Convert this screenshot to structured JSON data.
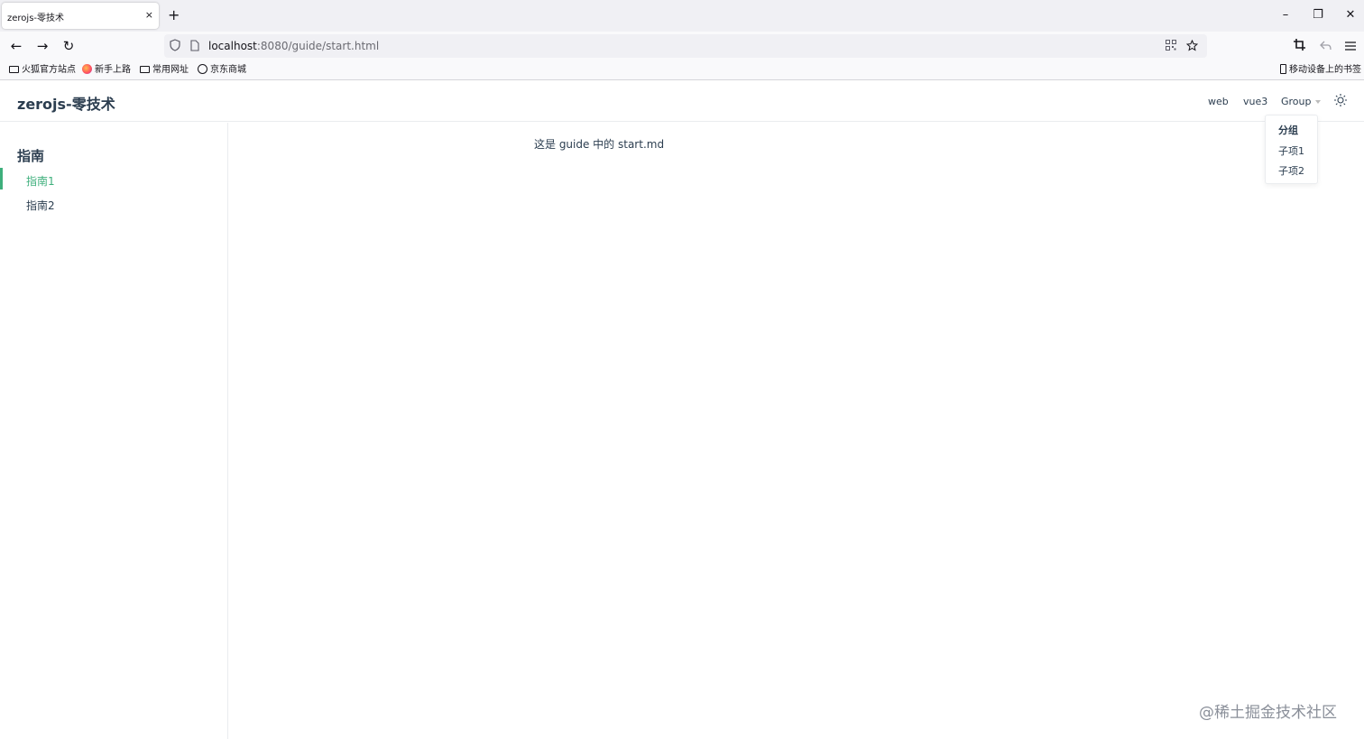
{
  "browser": {
    "tab": {
      "title": "zerojs-零技术",
      "close": "×"
    },
    "new_tab": "+",
    "window": {
      "minimize": "–",
      "restore": "❐",
      "close": "✕"
    },
    "nav": {
      "back": "←",
      "forward": "→",
      "reload": "↻"
    },
    "url": {
      "host": "localhost",
      "path": ":8080/guide/start.html"
    },
    "bookmarks": [
      {
        "label": "火狐官方站点",
        "icon": "folder-icon"
      },
      {
        "label": "新手上路",
        "icon": "firefox-icon"
      },
      {
        "label": "常用网址",
        "icon": "folder-icon"
      },
      {
        "label": "京东商城",
        "icon": "globe-icon"
      }
    ],
    "mobile_bookmarks": "移动设备上的书签"
  },
  "site": {
    "title": "zerojs-零技术",
    "nav": [
      {
        "label": "web"
      },
      {
        "label": "vue3"
      },
      {
        "label": "Group"
      }
    ],
    "dropdown": {
      "heading": "分组",
      "items": [
        "子项1",
        "子项2"
      ]
    }
  },
  "sidebar": {
    "heading": "指南",
    "items": [
      {
        "label": "指南1",
        "active": true
      },
      {
        "label": "指南2",
        "active": false
      }
    ]
  },
  "content": {
    "text": "这是 guide 中的 start.md"
  },
  "watermark": "@稀土掘金技术社区",
  "colors": {
    "accent": "#3eaf7c",
    "text": "#2c3e50",
    "border": "#eaecef"
  }
}
